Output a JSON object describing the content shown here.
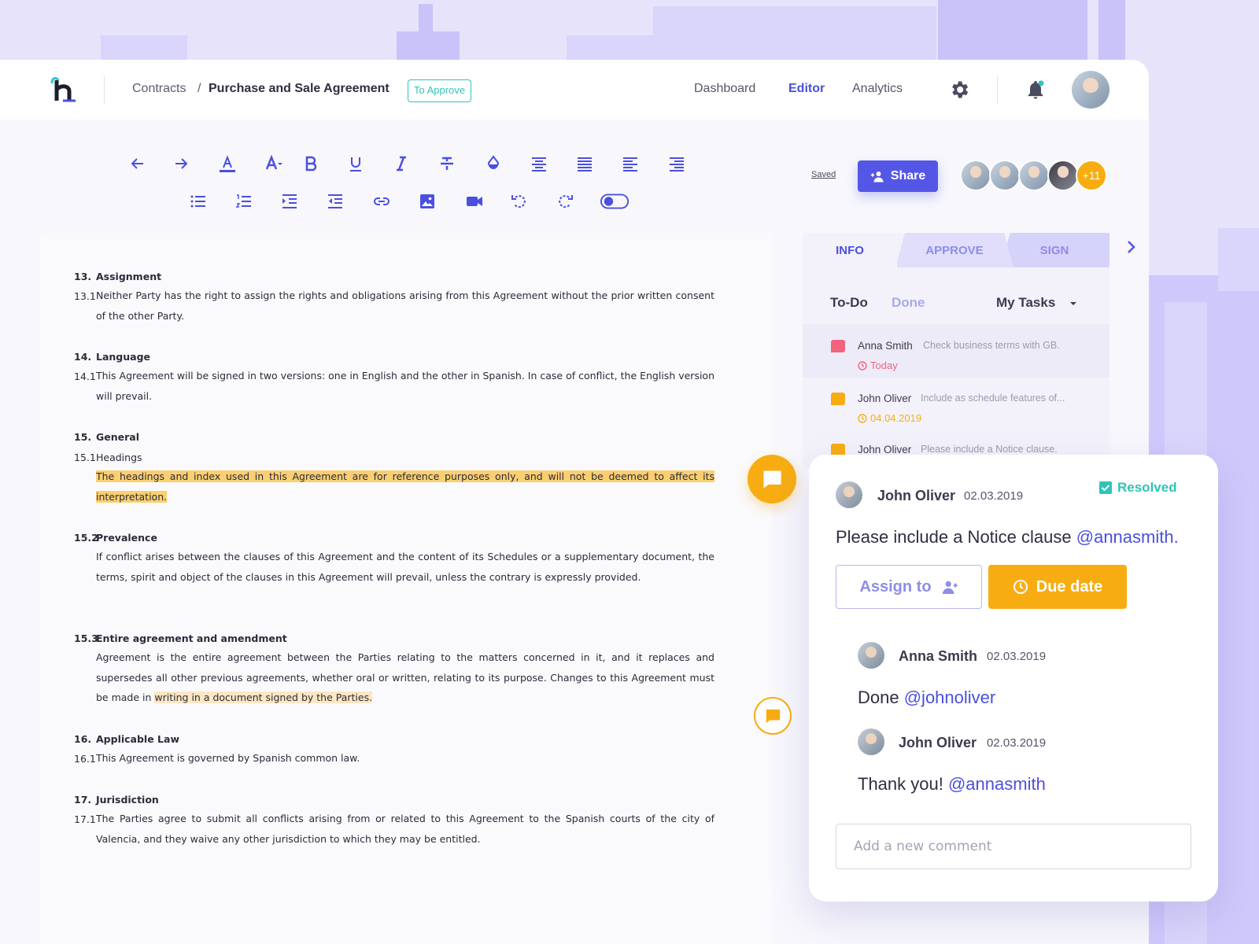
{
  "breadcrumb": {
    "parent": "Contracts",
    "separator": "/",
    "current": "Purchase and Sale Agreement",
    "status_badge": "To Approve"
  },
  "nav": {
    "dashboard": "Dashboard",
    "editor": "Editor",
    "analytics": "Analytics"
  },
  "toolbar": {
    "row1": [
      "undo-icon",
      "redo-icon",
      "font-color-icon",
      "font-size-icon",
      "bold-icon",
      "underline-icon",
      "italic-icon",
      "strikethrough-icon",
      "fill-color-icon",
      "align-center-icon",
      "align-justify-icon",
      "align-left-icon",
      "align-right-icon"
    ],
    "row2": [
      "bullet-list-icon",
      "numbered-list-icon",
      "indent-icon",
      "outdent-icon",
      "link-icon",
      "image-icon",
      "video-icon",
      "rotate-left-icon",
      "rotate-right-icon",
      "toggle-switch-icon"
    ],
    "saved_label": "Saved",
    "share_label": "Share",
    "collaborators_more": "+11"
  },
  "colors": {
    "accent": "#4b4fe0",
    "warning": "#f7ad12",
    "success": "#2ec4b6",
    "danger": "#f2637e",
    "background": "#e6e3fb"
  },
  "document": {
    "s13": {
      "num": "13.",
      "title": "Assignment",
      "p1_num": "13.1",
      "p1": "Neither Party has the right to assign the rights and obligations arising from this Agreement without the prior written consent of the other Party."
    },
    "s14": {
      "num": "14.",
      "title": "Language",
      "p1_num": "14.1",
      "p1": "This Agreement will be signed in two versions: one in English and the other in Spanish. In case of conflict, the English version will prevail."
    },
    "s15": {
      "num": "15.",
      "title": "General",
      "p1_num": "15.1",
      "p1_title": "Headings",
      "p1": "The headings and index used in this Agreement are for reference purposes only, and will not be deemed to affect its interpretation.",
      "p2_num": "15.2",
      "p2_title": "Prevalence",
      "p2": "If conflict arises between the clauses of this Agreement and the content of its Schedules or a supplementary document, the terms, spirit and object of the clauses in this Agreement will prevail, unless the contrary is expressly provided.",
      "p3_num": "15.3",
      "p3_title": "Entire agreement and amendment",
      "p3": "Agreement is the entire agreement between the Parties relating to the matters concerned in it, and it replaces and supersedes all other previous agreements, whether oral or written, relating to its purpose. Changes to this Agreement must be made in",
      "p3_highlight": "writing in a document signed by the Parties."
    },
    "s16": {
      "num": "16.",
      "title": "Applicable Law",
      "p1_num": "16.1",
      "p1": "This Agreement is governed by Spanish common law."
    },
    "s17": {
      "num": "17.",
      "title": "Jurisdiction",
      "p1_num": "17.1",
      "p1": "The Parties agree to submit all conflicts arising from or related to this Agreement to the Spanish courts of the city of Valencia, and they waive any other jurisdiction to which they may be entitled."
    }
  },
  "panel": {
    "tabs": [
      "INFO",
      "APPROVE",
      "SIGN"
    ],
    "filters": {
      "todo": "To-Do",
      "done": "Done",
      "scope": "My Tasks"
    },
    "tasks": [
      {
        "who": "Anna Smith",
        "what": "Check business terms with GB.",
        "when": "Today",
        "color": "#f2637e"
      },
      {
        "who": "John Oliver",
        "what": "Include as schedule features of...",
        "when": "04.04.2019",
        "color": "#f7ad12"
      },
      {
        "who": "John Oliver",
        "what": "Please include a Notice clause.",
        "when": "",
        "color": "#f7ad12"
      }
    ]
  },
  "comment_card": {
    "author": "John Oliver",
    "date": "02.03.2019",
    "status": "Resolved",
    "text": "Please include a Notice clause",
    "mention": "@annasmith.",
    "assign_label": "Assign to",
    "due_label": "Due date",
    "replies": [
      {
        "author": "Anna Smith",
        "date": "02.03.2019",
        "text": "Done",
        "mention": "@johnoliver"
      },
      {
        "author": "John Oliver",
        "date": "02.03.2019",
        "text": "Thank you!",
        "mention": "@annasmith"
      }
    ],
    "input_placeholder": "Add a new comment"
  }
}
